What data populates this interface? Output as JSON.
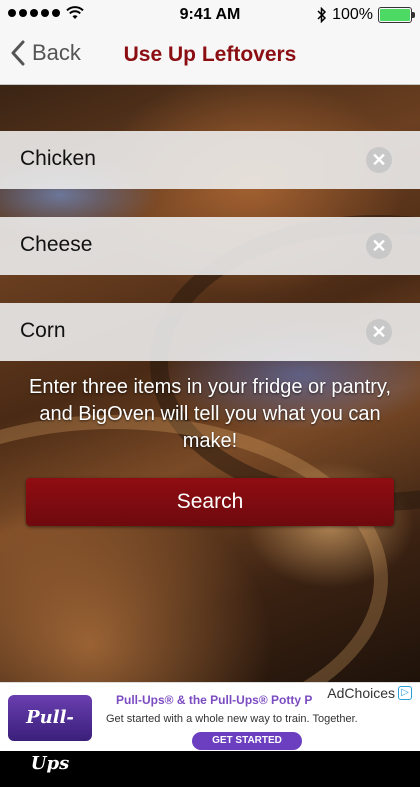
{
  "status_bar": {
    "time": "9:41 AM",
    "battery": "100%",
    "battery_level": 1.0,
    "icons": [
      "signal-dots-icon",
      "wifi-icon",
      "bluetooth-icon",
      "battery-icon"
    ]
  },
  "nav": {
    "back_label": "Back",
    "title": "Use Up Leftovers",
    "title_color": "#8b0e13"
  },
  "ingredients": [
    {
      "value": "Chicken",
      "clear_icon": "clear-icon"
    },
    {
      "value": "Cheese",
      "clear_icon": "clear-icon"
    },
    {
      "value": "Corn",
      "clear_icon": "clear-icon"
    }
  ],
  "instruction": "Enter three items in your fridge or pantry, and BigOven will tell you what you can make!",
  "search_button": "Search",
  "ad": {
    "logo_text": "Pull-Ups",
    "headline": "Pull-Ups® & the Pull-Ups® Potty P",
    "subtext": "Get started with a whole new way to train. Together.",
    "cta": "GET STARTED",
    "adchoices": "AdChoices",
    "accent": "#6c3fc0"
  }
}
